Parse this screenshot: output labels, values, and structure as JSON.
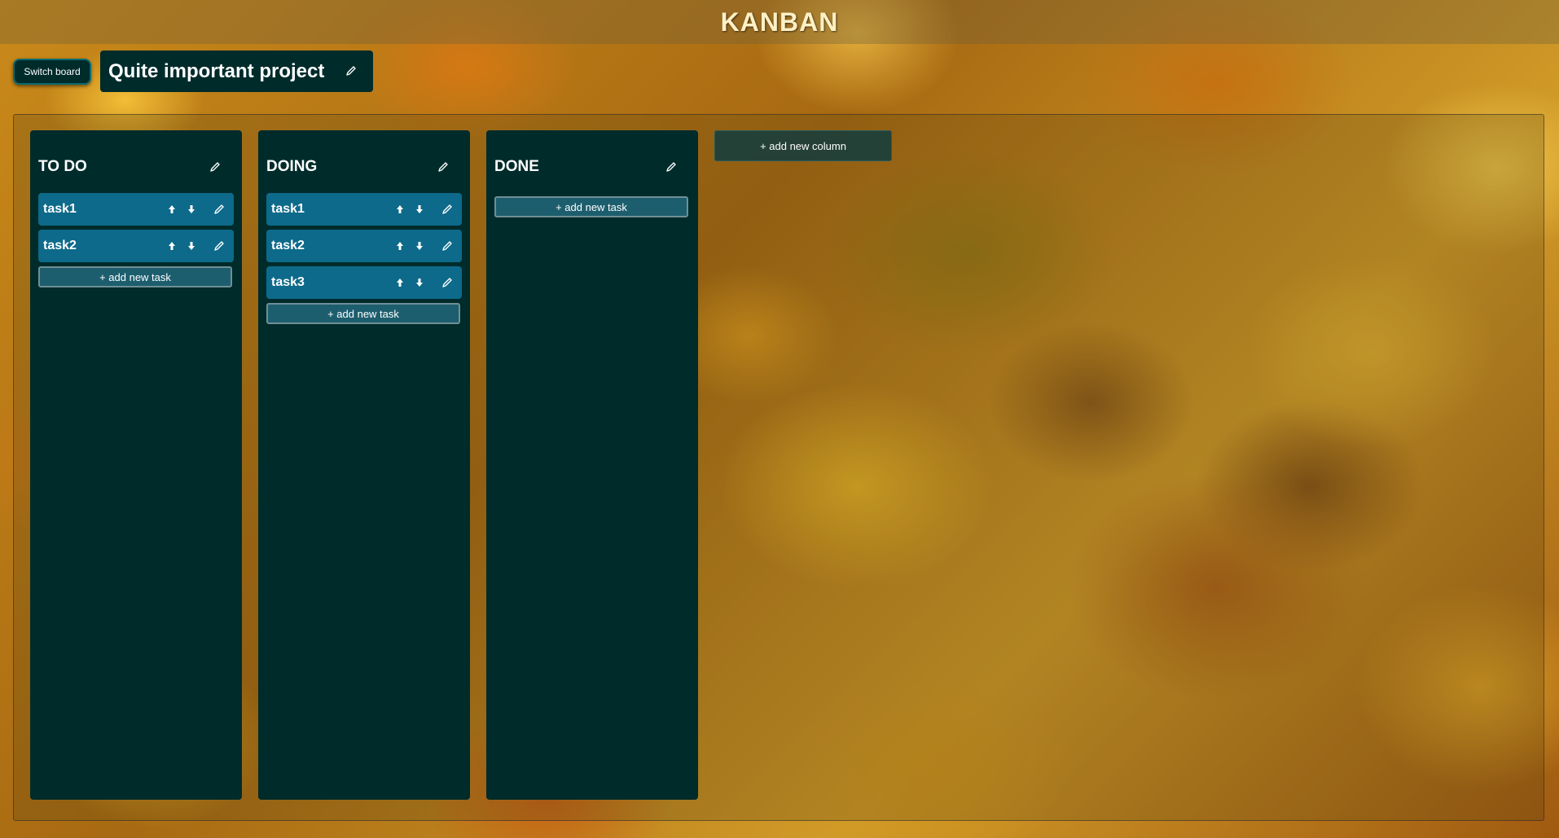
{
  "app_title": "KANBAN",
  "switch_board_label": "Switch board",
  "board": {
    "title": "Quite important project",
    "edit_icon": "pencil-icon"
  },
  "add_column_label": "+ add new column",
  "columns": [
    {
      "title": "TO DO",
      "tasks": [
        {
          "name": "task1"
        },
        {
          "name": "task2"
        }
      ],
      "add_task_label": "+ add new task"
    },
    {
      "title": "DOING",
      "tasks": [
        {
          "name": "task1"
        },
        {
          "name": "task2"
        },
        {
          "name": "task3"
        }
      ],
      "add_task_label": "+ add new task"
    },
    {
      "title": "DONE",
      "tasks": [],
      "add_task_label": "+ add new task"
    }
  ],
  "icons": {
    "move_up": "arrow-up-icon",
    "move_down": "arrow-down-icon",
    "edit": "pencil-icon"
  },
  "colors": {
    "panel": "#002b2b",
    "task": "#0d6a8a",
    "title_text": "#fdf0c4"
  }
}
